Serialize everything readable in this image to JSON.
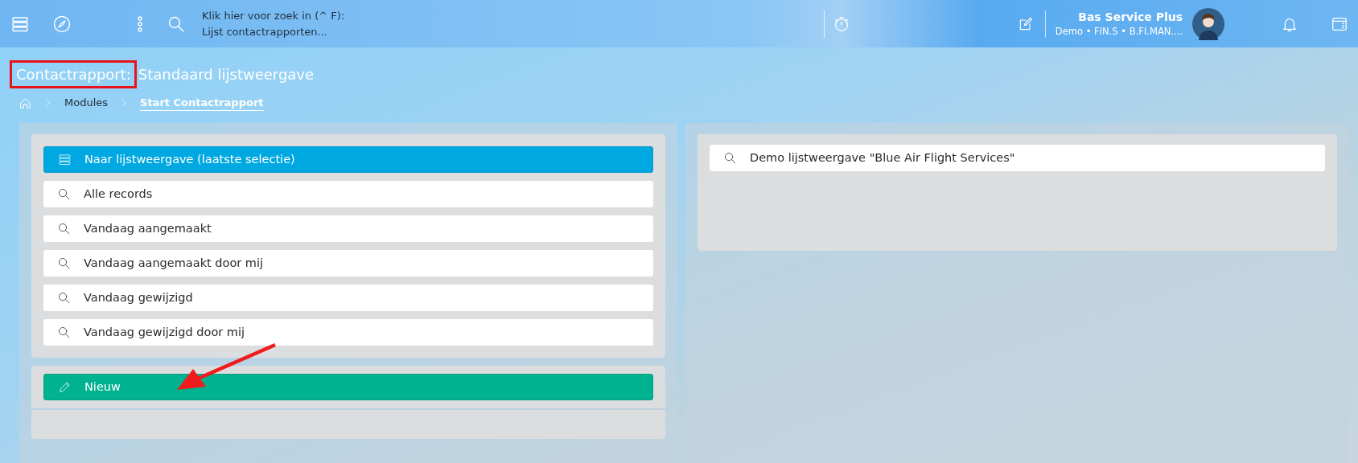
{
  "topbar": {
    "search_hint": "Klik hier voor zoek in (^ F):",
    "search_context": "Lijst contactrapporten...",
    "user": {
      "name": "Bas Service Plus",
      "detail": "Demo • FIN.S • B.FI.MAN...."
    }
  },
  "page_title": {
    "module": "Contactrapport:",
    "view": "Standaard lijstweergave"
  },
  "breadcrumb": [
    {
      "label": "Modules",
      "current": false
    },
    {
      "label": "Start Contactrapport",
      "current": true
    }
  ],
  "left_panel": {
    "actions": [
      {
        "kind": "list",
        "label": "Naar lijstweergave (laatste selectie)"
      },
      {
        "kind": "search",
        "label": "Alle records"
      },
      {
        "kind": "search",
        "label": "Vandaag aangemaakt"
      },
      {
        "kind": "search",
        "label": "Vandaag aangemaakt door mij"
      },
      {
        "kind": "search",
        "label": "Vandaag gewijzigd"
      },
      {
        "kind": "search",
        "label": "Vandaag gewijzigd door mij"
      }
    ],
    "new_actions": [
      {
        "kind": "new",
        "label": "Nieuw"
      }
    ]
  },
  "right_panel": {
    "views": [
      {
        "kind": "search",
        "label": "Demo lijstweergave \"Blue Air Flight Services\""
      }
    ]
  }
}
